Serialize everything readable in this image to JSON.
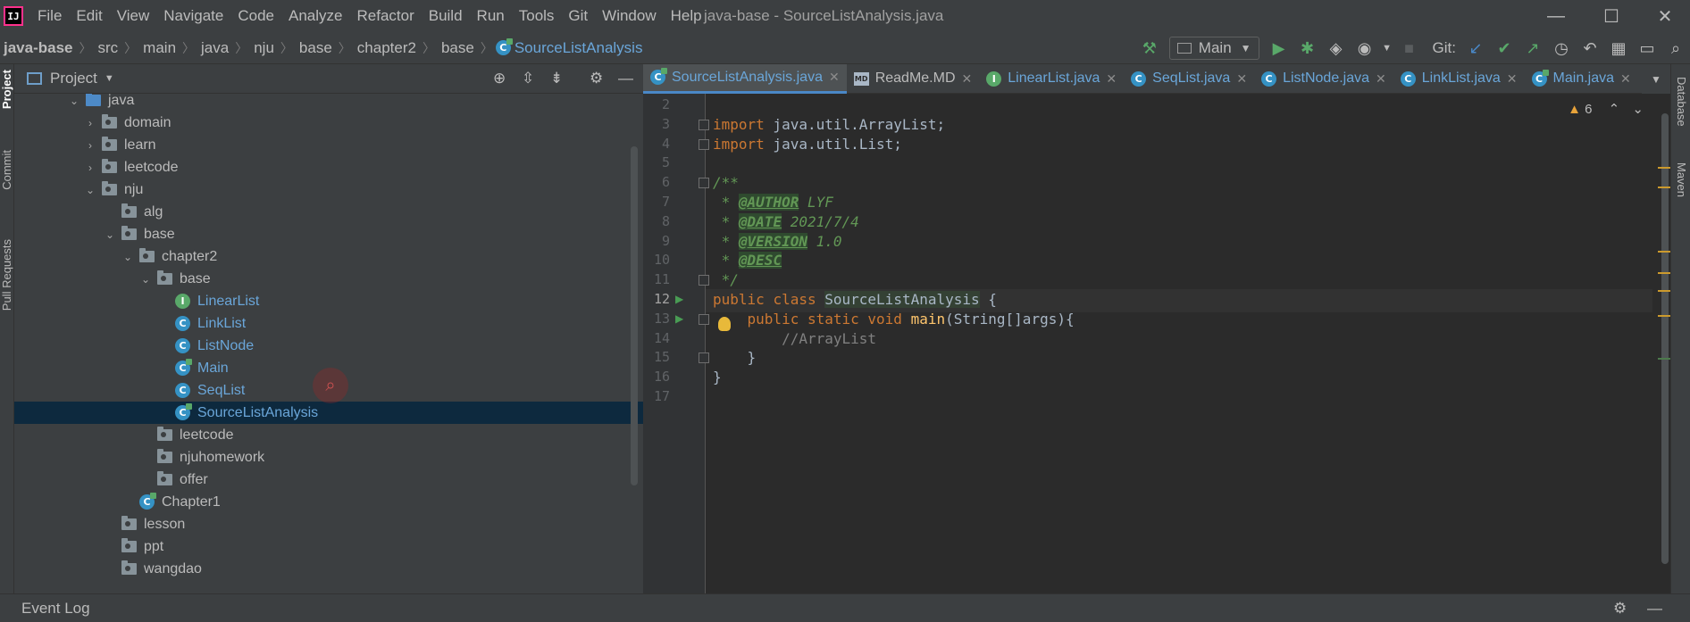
{
  "app": {
    "logo_text": "IJ",
    "window_title": "java-base - SourceListAnalysis.java"
  },
  "menu": [
    "File",
    "Edit",
    "View",
    "Navigate",
    "Code",
    "Analyze",
    "Refactor",
    "Build",
    "Run",
    "Tools",
    "Git",
    "Window",
    "Help"
  ],
  "window_controls": {
    "minimize": "—",
    "maximize": "☐",
    "close": "✕"
  },
  "breadcrumb": [
    "java-base",
    "src",
    "main",
    "java",
    "nju",
    "base",
    "chapter2",
    "base",
    "SourceListAnalysis"
  ],
  "toolbar": {
    "run_config": "Main",
    "git_label": "Git:"
  },
  "sidebar_left": {
    "project": "Project",
    "commit": "Commit",
    "pull_requests": "Pull Requests"
  },
  "sidebar_right": {
    "database": "Database",
    "maven": "Maven"
  },
  "project_panel": {
    "title": "Project"
  },
  "tree": [
    {
      "label": "java",
      "type": "src",
      "depth": 0,
      "expanded": true
    },
    {
      "label": "domain",
      "type": "pkg",
      "depth": 1,
      "expanded": false
    },
    {
      "label": "learn",
      "type": "pkg",
      "depth": 1,
      "expanded": false
    },
    {
      "label": "leetcode",
      "type": "pkg",
      "depth": 1,
      "expanded": false
    },
    {
      "label": "nju",
      "type": "pkg",
      "depth": 1,
      "expanded": true
    },
    {
      "label": "alg",
      "type": "pkg",
      "depth": 2,
      "expanded": null
    },
    {
      "label": "base",
      "type": "pkg",
      "depth": 2,
      "expanded": true
    },
    {
      "label": "chapter2",
      "type": "pkg",
      "depth": 3,
      "expanded": true
    },
    {
      "label": "base",
      "type": "pkg",
      "depth": 4,
      "expanded": true
    },
    {
      "label": "LinearList",
      "type": "interface",
      "depth": 5
    },
    {
      "label": "LinkList",
      "type": "class",
      "depth": 5
    },
    {
      "label": "ListNode",
      "type": "class",
      "depth": 5
    },
    {
      "label": "Main",
      "type": "main",
      "depth": 5
    },
    {
      "label": "SeqList",
      "type": "class",
      "depth": 5
    },
    {
      "label": "SourceListAnalysis",
      "type": "main",
      "depth": 5,
      "selected": true
    },
    {
      "label": "leetcode",
      "type": "pkg",
      "depth": 4
    },
    {
      "label": "njuhomework",
      "type": "pkg",
      "depth": 4
    },
    {
      "label": "offer",
      "type": "pkg",
      "depth": 4
    },
    {
      "label": "Chapter1",
      "type": "main",
      "depth": 3
    },
    {
      "label": "lesson",
      "type": "pkg",
      "depth": 2
    },
    {
      "label": "ppt",
      "type": "pkg",
      "depth": 2
    },
    {
      "label": "wangdao",
      "type": "pkg",
      "depth": 2
    }
  ],
  "editor_tabs": [
    {
      "label": "SourceListAnalysis.java",
      "icon": "main",
      "active": true
    },
    {
      "label": "ReadMe.MD",
      "icon": "md"
    },
    {
      "label": "LinearList.java",
      "icon": "interface"
    },
    {
      "label": "SeqList.java",
      "icon": "class"
    },
    {
      "label": "ListNode.java",
      "icon": "class"
    },
    {
      "label": "LinkList.java",
      "icon": "class"
    },
    {
      "label": "Main.java",
      "icon": "main"
    }
  ],
  "editor": {
    "warnings": "6",
    "current_line": 12,
    "lines": [
      {
        "n": "2",
        "code": ""
      },
      {
        "n": "3",
        "code": "import java.util.ArrayList;"
      },
      {
        "n": "4",
        "code": "import java.util.List;"
      },
      {
        "n": "5",
        "code": ""
      },
      {
        "n": "6",
        "code": "/**"
      },
      {
        "n": "7",
        "code": " * @AUTHOR LYF"
      },
      {
        "n": "8",
        "code": " * @DATE 2021/7/4"
      },
      {
        "n": "9",
        "code": " * @VERSION 1.0"
      },
      {
        "n": "10",
        "code": " * @DESC"
      },
      {
        "n": "11",
        "code": " */"
      },
      {
        "n": "12",
        "code": "public class SourceListAnalysis {"
      },
      {
        "n": "13",
        "code": "    public static void main(String[]args){"
      },
      {
        "n": "14",
        "code": "        //ArrayList"
      },
      {
        "n": "15",
        "code": "    }"
      },
      {
        "n": "16",
        "code": "}"
      },
      {
        "n": "17",
        "code": ""
      }
    ]
  },
  "bottom": {
    "event_log": "Event Log"
  }
}
